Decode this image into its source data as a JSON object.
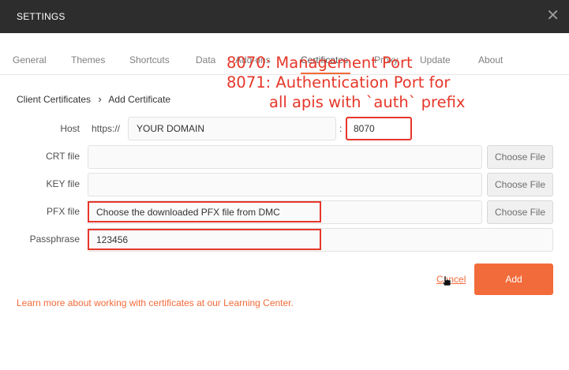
{
  "window": {
    "title": "SETTINGS",
    "close_glyph": "✕"
  },
  "tabs": [
    {
      "label": "General",
      "active": false
    },
    {
      "label": "Themes",
      "active": false
    },
    {
      "label": "Shortcuts",
      "active": false
    },
    {
      "label": "Data",
      "active": false
    },
    {
      "label": "Add-ons",
      "active": false
    },
    {
      "label": "Certificates",
      "active": true
    },
    {
      "label": "Proxy",
      "active": false
    },
    {
      "label": "Update",
      "active": false
    },
    {
      "label": "About",
      "active": false
    }
  ],
  "breadcrumb": {
    "parent": "Client Certificates",
    "separator": "›",
    "current": "Add Certificate"
  },
  "form": {
    "host": {
      "label": "Host",
      "prefix": "https://",
      "domain": "YOUR DOMAIN",
      "colon": ":",
      "port": "8070"
    },
    "crt": {
      "label": "CRT file",
      "button": "Choose File"
    },
    "key": {
      "label": "KEY file",
      "button": "Choose File"
    },
    "pfx": {
      "label": "PFX file",
      "value": "Choose the downloaded PFX file from DMC",
      "button": "Choose File"
    },
    "passphrase": {
      "label": "Passphrase",
      "value": "123456"
    }
  },
  "actions": {
    "cancel": "Cancel",
    "add": "Add"
  },
  "learn_more": "Learn more about working with certificates at our Learning Center.",
  "annotation": {
    "line1": "8070: Management Port",
    "line2": "8071: Authentication Port for",
    "line3": "all apis with `auth` prefix",
    "color": "#e6372a"
  },
  "colors": {
    "accent": "#f26b3a",
    "titlebar": "#2d2d2d"
  }
}
